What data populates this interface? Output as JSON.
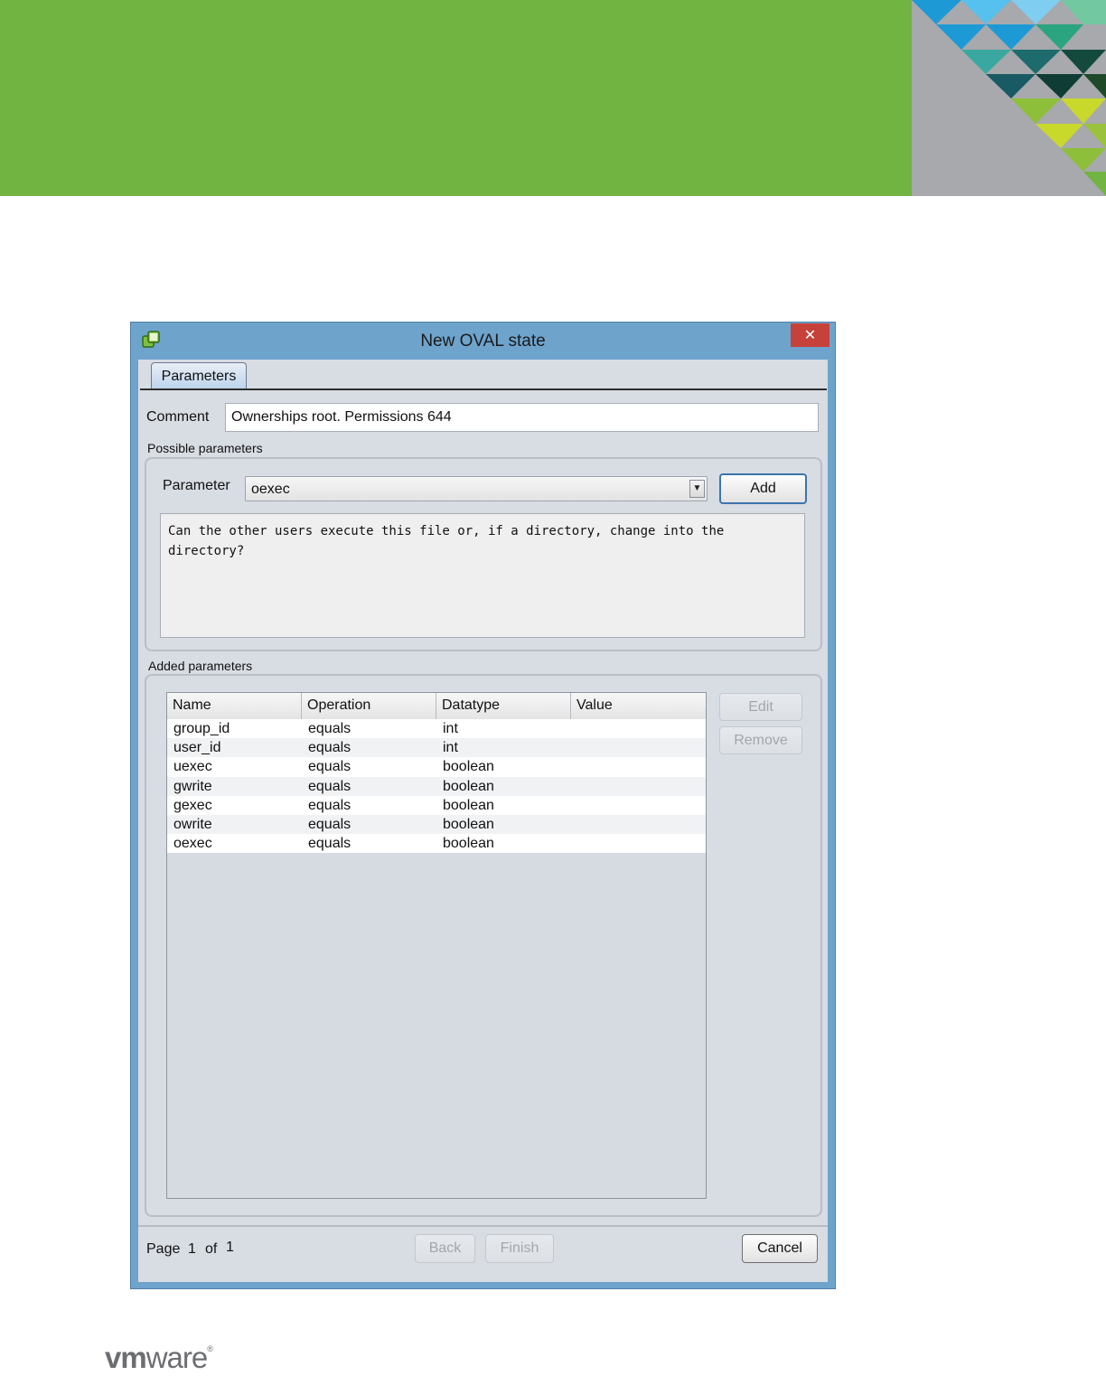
{
  "window": {
    "title": "New OVAL state",
    "close_symbol": "✕"
  },
  "tabs": [
    {
      "label": "Parameters",
      "selected": true
    }
  ],
  "comment": {
    "label": "Comment",
    "value": "Ownerships root. Permissions 644"
  },
  "possible_parameters": {
    "group_title": "Possible parameters",
    "parameter_label": "Parameter",
    "selected_value": "oexec",
    "add_label": "Add",
    "description": "Can the other users execute this file or, if a directory, change into the\ndirectory?"
  },
  "added_parameters": {
    "group_title": "Added parameters",
    "columns": [
      "Name",
      "Operation",
      "Datatype",
      "Value"
    ],
    "rows": [
      {
        "name": "group_id",
        "operation": "equals",
        "datatype": "int",
        "value": ""
      },
      {
        "name": "user_id",
        "operation": "equals",
        "datatype": "int",
        "value": ""
      },
      {
        "name": "uexec",
        "operation": "equals",
        "datatype": "boolean",
        "value": ""
      },
      {
        "name": "gwrite",
        "operation": "equals",
        "datatype": "boolean",
        "value": ""
      },
      {
        "name": "gexec",
        "operation": "equals",
        "datatype": "boolean",
        "value": ""
      },
      {
        "name": "owrite",
        "operation": "equals",
        "datatype": "boolean",
        "value": ""
      },
      {
        "name": "oexec",
        "operation": "equals",
        "datatype": "boolean",
        "value": ""
      }
    ],
    "edit_label": "Edit",
    "remove_label": "Remove"
  },
  "footer": {
    "page_label": "Page",
    "page_current": "1",
    "of_label": "of",
    "page_total": "1",
    "back_label": "Back",
    "finish_label": "Finish",
    "cancel_label": "Cancel"
  },
  "brand": {
    "logo_vm": "vm",
    "logo_ware": "ware",
    "logo_reg": "®"
  },
  "colors": {
    "banner_green": "#71b441",
    "window_frame": "#6ea3cc",
    "close_red": "#c7413b",
    "dialog_bg": "#d8dce3"
  }
}
